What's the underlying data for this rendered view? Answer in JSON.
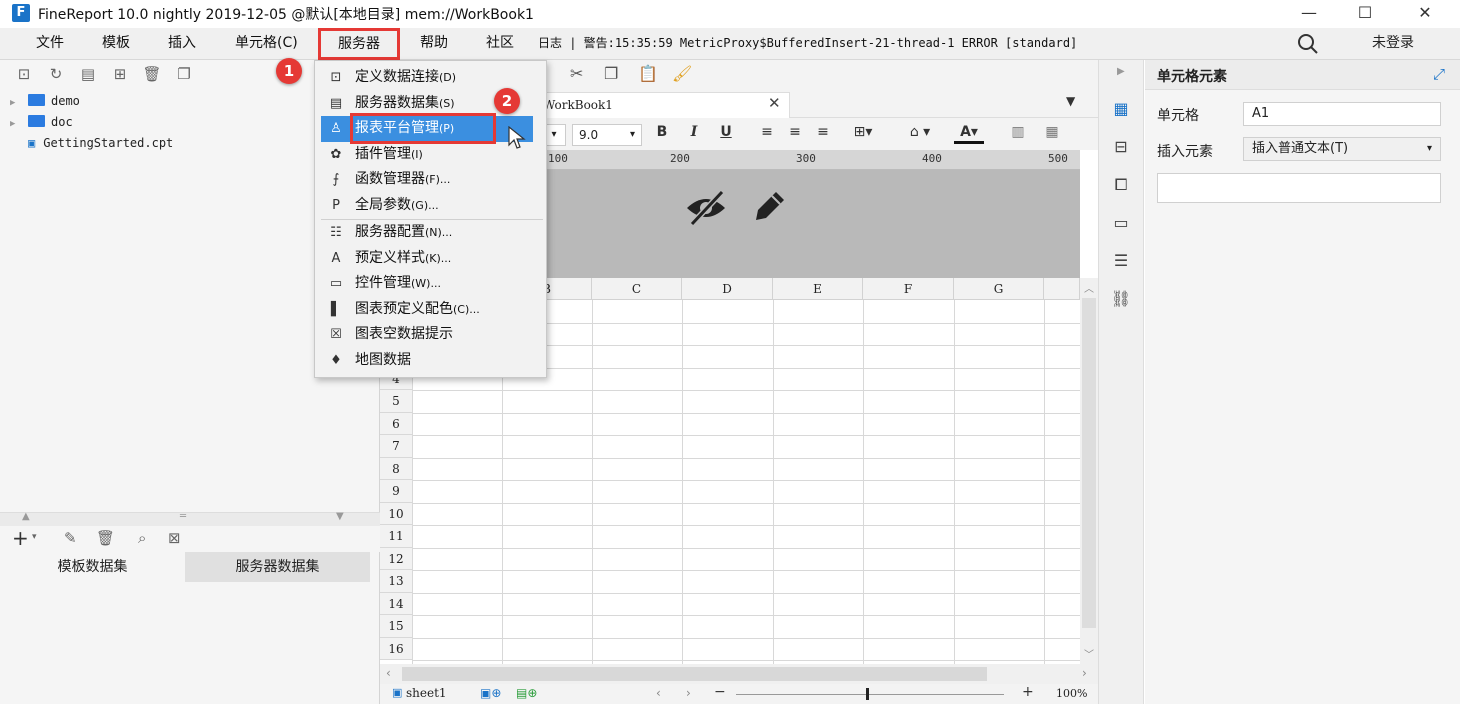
{
  "window": {
    "title": "FineReport 10.0 nightly 2019-12-05 @默认[本地目录]   mem://WorkBook1",
    "minimize": "—",
    "maximize": "☐",
    "close": "✕"
  },
  "menubar": {
    "items": [
      "文件",
      "模板",
      "插入",
      "单元格(C)",
      "服务器",
      "帮助",
      "社区"
    ],
    "log": "日志 | 警告:15:35:59 MetricProxy$BufferedInsert-21-thread-1 ERROR [standard]",
    "login": "未登录"
  },
  "tree": {
    "items": [
      "demo",
      "doc",
      "GettingStarted.cpt"
    ]
  },
  "dataset_tabs": [
    "模板数据集",
    "服务器数据集"
  ],
  "sheet": {
    "tab_title": "WorkBook1",
    "font_size": "9.0",
    "ruler_ticks": [
      "100",
      "200",
      "300",
      "400",
      "500"
    ],
    "columns": [
      "B",
      "C",
      "D",
      "E",
      "F",
      "G"
    ],
    "rows": [
      "4",
      "5",
      "6",
      "7",
      "8",
      "9",
      "10",
      "11",
      "12",
      "13",
      "14",
      "15",
      "16"
    ],
    "sheet_name": "sheet1",
    "zoom": "100%"
  },
  "right_panel": {
    "title": "单元格元素",
    "cell_label": "单元格",
    "cell_value": "A1",
    "insert_label": "插入元素",
    "insert_value": "插入普通文本(T)"
  },
  "dropdown": {
    "items": [
      {
        "label": "定义数据连接",
        "shortcut": "(D)",
        "icon": "db-connection-icon"
      },
      {
        "label": "服务器数据集",
        "shortcut": "(S)",
        "icon": "server-dataset-icon"
      },
      {
        "label": "报表平台管理",
        "shortcut": "(P)",
        "icon": "platform-user-icon"
      },
      {
        "label": "插件管理",
        "shortcut": "(I)",
        "icon": "plugin-icon"
      },
      {
        "label": "函数管理器",
        "shortcut": "(F)...",
        "icon": "function-icon"
      },
      {
        "label": "全局参数",
        "shortcut": "(G)...",
        "icon": "param-icon"
      },
      {
        "label": "服务器配置",
        "shortcut": "(N)...",
        "icon": "server-config-icon"
      },
      {
        "label": "预定义样式",
        "shortcut": "(K)...",
        "icon": "style-icon"
      },
      {
        "label": "控件管理",
        "shortcut": "(W)...",
        "icon": "widget-icon"
      },
      {
        "label": "图表预定义配色",
        "shortcut": "(C)...",
        "icon": "chart-color-icon"
      },
      {
        "label": "图表空数据提示",
        "shortcut": "",
        "icon": "chart-empty-icon"
      },
      {
        "label": "地图数据",
        "shortcut": "",
        "icon": "map-data-icon"
      }
    ]
  },
  "annotations": {
    "badge1": "1",
    "badge2": "2"
  },
  "colors": {
    "accent": "#3b8fe0",
    "highlight_red": "#e53935",
    "folder": "#2b7be0"
  }
}
